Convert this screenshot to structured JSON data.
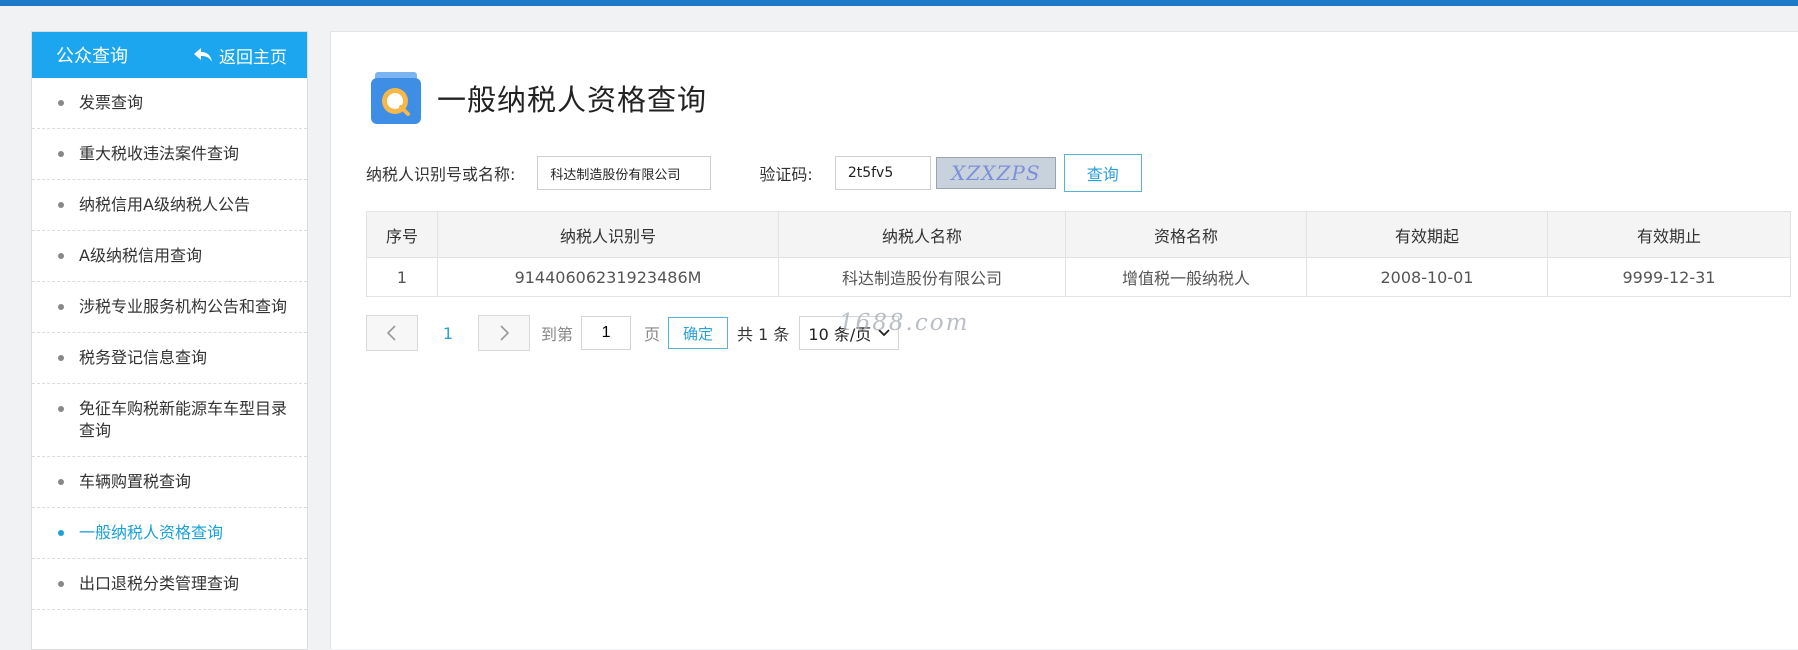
{
  "sidebar": {
    "title": "公众查询",
    "back_label": "返回主页",
    "items": [
      {
        "label": "发票查询"
      },
      {
        "label": "重大税收违法案件查询"
      },
      {
        "label": "纳税信用A级纳税人公告"
      },
      {
        "label": "A级纳税信用查询"
      },
      {
        "label": "涉税专业服务机构公告和查询"
      },
      {
        "label": "税务登记信息查询"
      },
      {
        "label": "免征车购税新能源车车型目录查询"
      },
      {
        "label": "车辆购置税查询"
      },
      {
        "label": "一般纳税人资格查询",
        "active": true
      },
      {
        "label": "出口退税分类管理查询"
      }
    ]
  },
  "main": {
    "title": "一般纳税人资格查询",
    "form": {
      "name_label": "纳税人识别号或名称:",
      "name_value": "科达制造股份有限公司",
      "captcha_label": "验证码:",
      "captcha_value": "2t5fv5",
      "captcha_image_text": "XZXZPS",
      "query_button": "查询"
    },
    "table": {
      "headers": [
        "序号",
        "纳税人识别号",
        "纳税人名称",
        "资格名称",
        "有效期起",
        "有效期止"
      ],
      "rows": [
        [
          "1",
          "91440606231923486M",
          "科达制造股份有限公司",
          "增值税一般纳税人",
          "2008-10-01",
          "9999-12-31"
        ]
      ]
    },
    "pagination": {
      "prev_icon": "chevron-left-icon",
      "next_icon": "chevron-right-icon",
      "current_page": "1",
      "goto_label": "到第",
      "goto_value": "1",
      "page_unit": "页",
      "confirm_label": "确定",
      "total_label": "共 1 条",
      "page_size_label": "10 条/页"
    },
    "watermark": "1688.com"
  },
  "colors": {
    "accent": "#1ba6ef",
    "link": "#2aa0d8",
    "topbar": "#1e79c6"
  }
}
